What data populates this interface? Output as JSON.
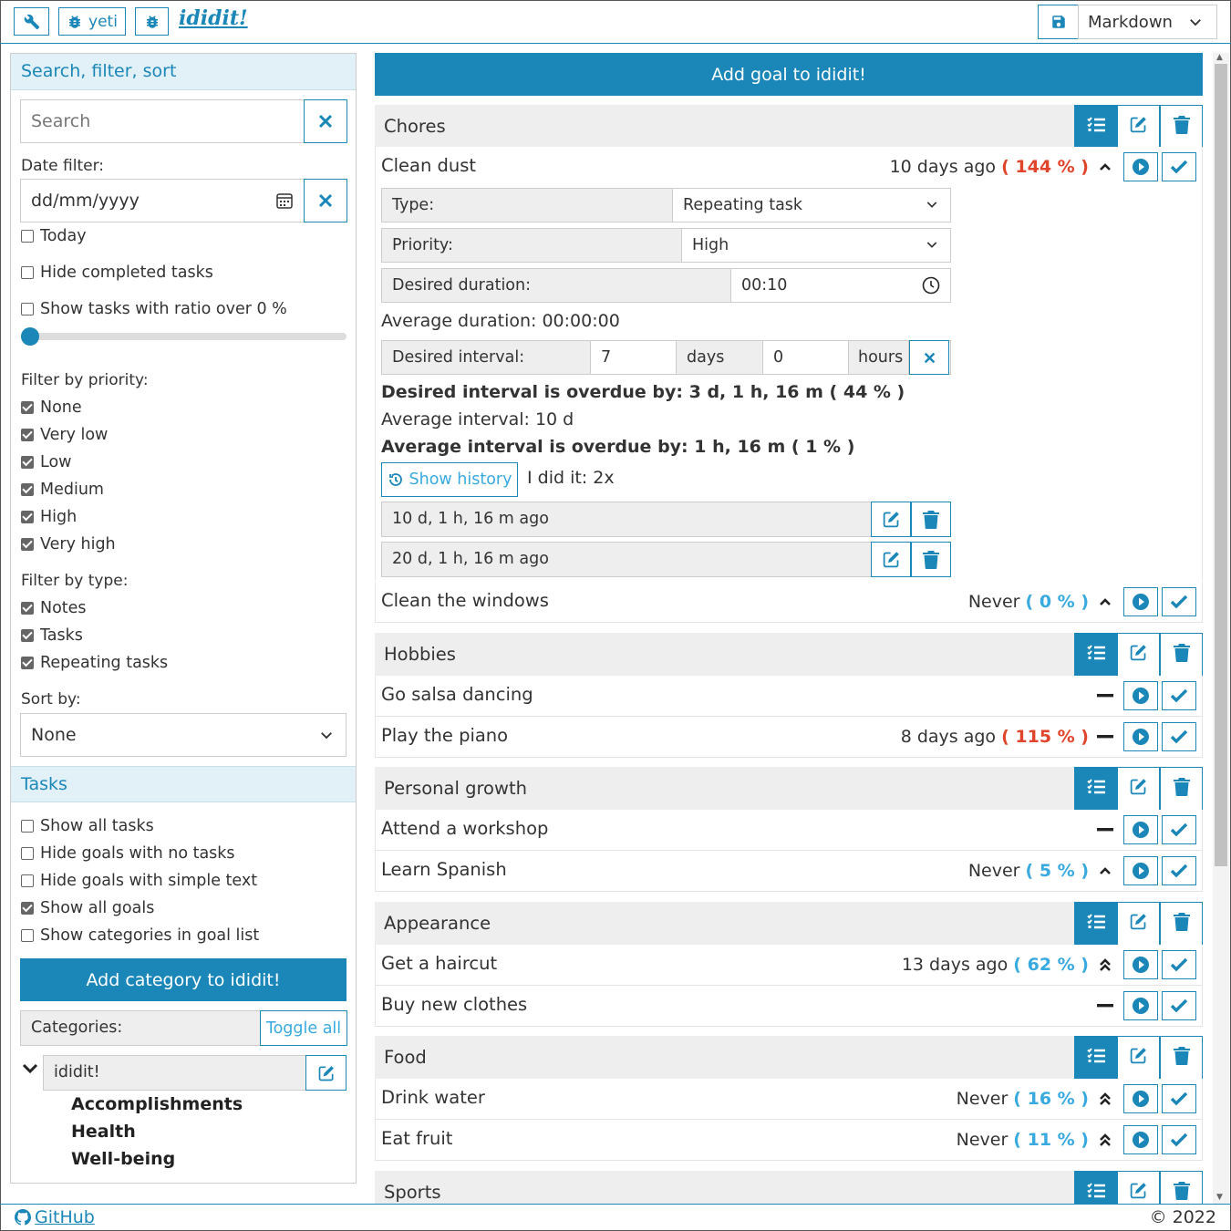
{
  "topbar": {
    "tool_icon": "wrench-icon",
    "yeti_label": "yeti",
    "logo_text": "ididit!",
    "save_icon": "floppy-disk-icon",
    "format_select": "Markdown"
  },
  "sidebar": {
    "search_header": "Search, filter, sort",
    "search_placeholder": "Search",
    "date_filter_label": "Date filter:",
    "date_placeholder": "dd/mm/yyyy",
    "today_label": "Today",
    "hide_completed_label": "Hide completed tasks",
    "ratio_label": "Show tasks with ratio over 0 %",
    "ratio_value": 0,
    "priority_label": "Filter by priority:",
    "priorities": [
      {
        "label": "None",
        "checked": true
      },
      {
        "label": "Very low",
        "checked": true
      },
      {
        "label": "Low",
        "checked": true
      },
      {
        "label": "Medium",
        "checked": true
      },
      {
        "label": "High",
        "checked": true
      },
      {
        "label": "Very high",
        "checked": true
      }
    ],
    "type_label": "Filter by type:",
    "types": [
      {
        "label": "Notes",
        "checked": true
      },
      {
        "label": "Tasks",
        "checked": true
      },
      {
        "label": "Repeating tasks",
        "checked": true
      }
    ],
    "sort_label": "Sort by:",
    "sort_value": "None",
    "tasks_header": "Tasks",
    "task_options": [
      {
        "label": "Show all tasks",
        "checked": false
      },
      {
        "label": "Hide goals with no tasks",
        "checked": false
      },
      {
        "label": "Hide goals with simple text",
        "checked": false
      },
      {
        "label": "Show all goals",
        "checked": true
      },
      {
        "label": "Show categories in goal list",
        "checked": false
      }
    ],
    "add_category_label": "Add category to ididit!",
    "categories_label": "Categories:",
    "toggle_all_label": "Toggle all",
    "root_category": "ididit!",
    "subcategories": [
      "Accomplishments",
      "Health",
      "Well-being"
    ]
  },
  "main": {
    "add_goal_label": "Add goal to ididit!",
    "categories": [
      {
        "title": "Chores"
      },
      {
        "title": "Hobbies"
      },
      {
        "title": "Personal growth"
      },
      {
        "title": "Appearance"
      },
      {
        "title": "Food"
      },
      {
        "title": "Sports"
      }
    ],
    "goals": [
      {
        "name": "Clean dust",
        "stat": "10 days ago ",
        "pct": "( 144 % )",
        "pct_color": "red",
        "priority_icon": "chevron-up-icon"
      },
      {
        "name": "Clean the windows",
        "stat": "Never ",
        "pct": "( 0 % )",
        "pct_color": "blue",
        "priority_icon": "chevron-up-icon"
      },
      {
        "name": "Go salsa dancing",
        "stat": "",
        "pct": "",
        "pct_color": "",
        "priority_icon": "dash-icon"
      },
      {
        "name": "Play the piano",
        "stat": "8 days ago ",
        "pct": "( 115 % )",
        "pct_color": "red",
        "priority_icon": "dash-icon"
      },
      {
        "name": "Attend a workshop",
        "stat": "",
        "pct": "",
        "pct_color": "",
        "priority_icon": "dash-icon"
      },
      {
        "name": "Learn Spanish",
        "stat": "Never ",
        "pct": "( 5 % )",
        "pct_color": "blue",
        "priority_icon": "chevron-up-icon"
      },
      {
        "name": "Get a haircut",
        "stat": "13 days ago ",
        "pct": "( 62 % )",
        "pct_color": "blue",
        "priority_icon": "double-chevron-up-icon"
      },
      {
        "name": "Buy new clothes",
        "stat": "",
        "pct": "",
        "pct_color": "",
        "priority_icon": "dash-icon"
      },
      {
        "name": "Drink water",
        "stat": "Never ",
        "pct": "( 16 % )",
        "pct_color": "blue",
        "priority_icon": "double-chevron-up-icon"
      },
      {
        "name": "Eat fruit",
        "stat": "Never ",
        "pct": "( 11 % )",
        "pct_color": "blue",
        "priority_icon": "double-chevron-up-icon"
      }
    ],
    "detail": {
      "type_label": "Type:",
      "type_value": "Repeating task",
      "priority_label": "Priority:",
      "priority_value": "High",
      "duration_label": "Desired duration:",
      "duration_value": "00:10",
      "avg_duration": "Average duration: 00:00:00",
      "interval_label": "Desired interval:",
      "interval_days": "7",
      "days_label": "days",
      "interval_hours": "0",
      "hours_label": "hours",
      "overdue_desired": "Desired interval is overdue by: 3 d, 1 h, 16 m ( 44 % )",
      "avg_interval": "Average interval: 10 d",
      "overdue_avg": "Average interval is overdue by: 1 h, 16 m ( 1 % )",
      "show_history_label": "Show history",
      "did_it": "I did it: 2x",
      "history": [
        "10 d, 1 h, 16 m ago",
        "20 d, 1 h, 16 m ago"
      ]
    }
  },
  "footer": {
    "github_label": "GitHub",
    "copyright": "© 2022"
  },
  "colors": {
    "accent": "#1a87b8",
    "overdue_red": "#e0442a",
    "ok_blue": "#39aadf"
  }
}
